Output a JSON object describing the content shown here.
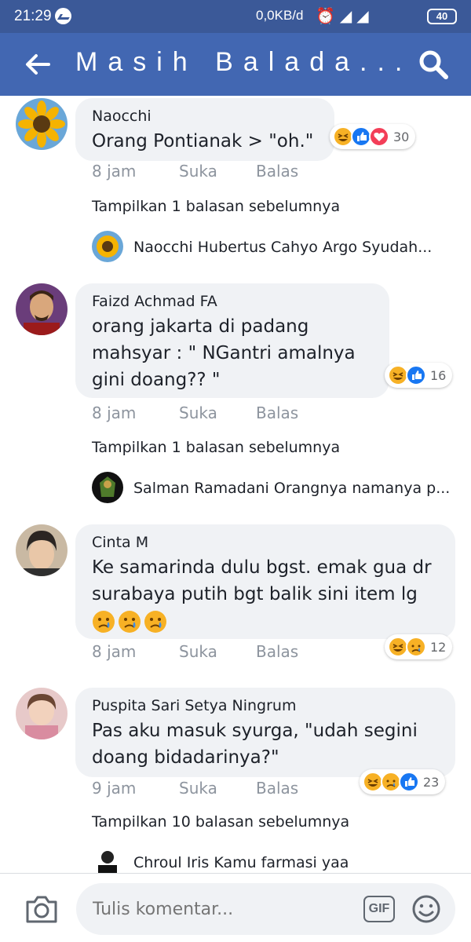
{
  "status_bar": {
    "time": "21:29",
    "network_speed": "0,0KB/d",
    "battery": "40",
    "icons": [
      "messenger-icon",
      "alarm-icon",
      "signal-icon",
      "volte-icon",
      "wifi-icon",
      "battery-icon"
    ]
  },
  "header": {
    "title": "Masih Balada...",
    "background": "#4267b2"
  },
  "comments": [
    {
      "name": "Naocchi",
      "text": "Orang Pontianak > \"oh.\"",
      "time": "8 jam",
      "like_label": "Suka",
      "reply_label": "Balas",
      "reactions": [
        "haha",
        "like",
        "love"
      ],
      "reaction_count": "30",
      "show_replies": "Tampilkan 1 balasan sebelumnya",
      "reply_preview": "Naocchi Hubertus Cahyo Argo Syudah..."
    },
    {
      "name": "Faizd Achmad FA",
      "text": "orang jakarta di padang mahsyar : \" NGantri amalnya gini doang?? \"",
      "lines": [
        "orang jakarta di padang",
        "mahsyar : \" NGantri amalnya",
        "gini doang?? \""
      ],
      "time": "8 jam",
      "like_label": "Suka",
      "reply_label": "Balas",
      "reactions": [
        "haha",
        "like"
      ],
      "reaction_count": "16",
      "show_replies": "Tampilkan 1 balasan sebelumnya",
      "reply_preview": "Salman Ramadani Orangnya namanya p..."
    },
    {
      "name": "Cinta M",
      "lines": [
        "Ke samarinda dulu bgst. emak gua dr",
        "surabaya putih bgt balik sini item lg"
      ],
      "time": "8 jam",
      "like_label": "Suka",
      "reply_label": "Balas",
      "reactions": [
        "haha",
        "sad"
      ],
      "reaction_count": "12",
      "emoji": [
        "crying-face",
        "crying-face",
        "crying-face"
      ]
    },
    {
      "name": "Puspita Sari Setya Ningrum",
      "lines": [
        "Pas aku masuk syurga, \"udah segini",
        "doang bidadarinya?\""
      ],
      "time": "9 jam",
      "like_label": "Suka",
      "reply_label": "Balas",
      "reactions": [
        "haha",
        "sad",
        "like"
      ],
      "reaction_count": "23",
      "show_replies": "Tampilkan 10 balasan sebelumnya",
      "reply_preview": "Chroul Iris Kamu farmasi yaa"
    }
  ],
  "composer": {
    "placeholder": "Tulis komentar...",
    "gif_label": "GIF"
  }
}
